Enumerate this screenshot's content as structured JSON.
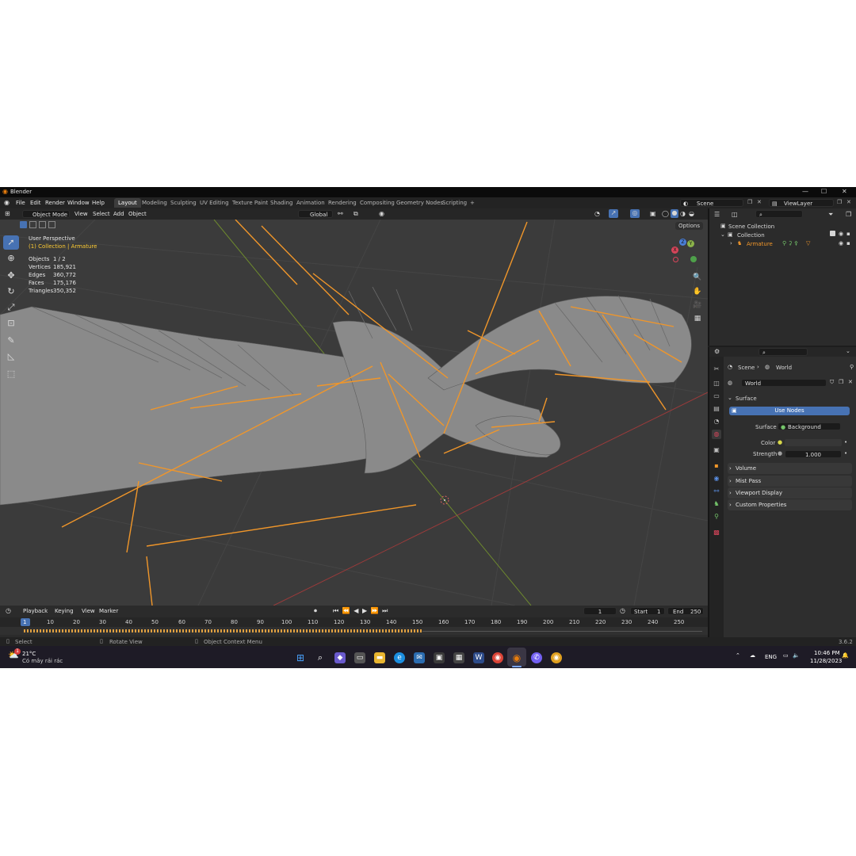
{
  "window": {
    "title": "Blender",
    "controls": [
      "—",
      "☐",
      "✕"
    ]
  },
  "menu": [
    "File",
    "Edit",
    "Render",
    "Window",
    "Help"
  ],
  "workspaces": [
    "Layout",
    "Modeling",
    "Sculpting",
    "UV Editing",
    "Texture Paint",
    "Shading",
    "Animation",
    "Rendering",
    "Compositing",
    "Geometry Nodes",
    "Scripting",
    "+"
  ],
  "scene_field": "Scene",
  "viewlayer_field": "ViewLayer",
  "viewport_header": {
    "mode": "Object Mode",
    "menus": [
      "View",
      "Select",
      "Add",
      "Object"
    ],
    "transform": "Global",
    "options": "Options"
  },
  "viewport_info": {
    "perspective": "User Perspective",
    "collection": "(1) Collection | Armature",
    "stats": [
      {
        "label": "Objects",
        "value": "1 / 2"
      },
      {
        "label": "Vertices",
        "value": "185,921"
      },
      {
        "label": "Edges",
        "value": "360,772"
      },
      {
        "label": "Faces",
        "value": "175,176"
      },
      {
        "label": "Triangles",
        "value": "350,352"
      }
    ]
  },
  "gizmo": {
    "axes": [
      "X",
      "Y",
      "Z"
    ]
  },
  "outliner": {
    "items": [
      "Scene Collection",
      "Collection",
      "Armature"
    ]
  },
  "properties": {
    "breadcrumb": [
      "Scene",
      "World"
    ],
    "world_name": "World",
    "surface_panel": "Surface",
    "use_nodes": "Use Nodes",
    "surface_label": "Surface",
    "surface_value": "Background",
    "color_label": "Color",
    "strength_label": "Strength",
    "strength_value": "1.000",
    "panels": [
      "Volume",
      "Mist Pass",
      "Viewport Display",
      "Custom Properties"
    ]
  },
  "timeline": {
    "menus": [
      "Playback",
      "Keying",
      "View",
      "Marker"
    ],
    "current_frame": "1",
    "start_label": "Start",
    "start_value": "1",
    "end_label": "End",
    "end_value": "250",
    "ruler": [
      "1",
      "10",
      "20",
      "30",
      "40",
      "50",
      "60",
      "70",
      "80",
      "90",
      "100",
      "110",
      "120",
      "130",
      "140",
      "150",
      "160",
      "170",
      "180",
      "190",
      "200",
      "210",
      "220",
      "230",
      "240",
      "250"
    ]
  },
  "statusbar": {
    "select": "Select",
    "rotate": "Rotate View",
    "context": "Object Context Menu",
    "version": "3.6.2"
  },
  "taskbar": {
    "weather_temp": "21°C",
    "weather_desc": "Có mây rải rác",
    "weather_badge": "1",
    "lang": "ENG",
    "time": "10:46 PM",
    "date": "11/28/2023"
  }
}
